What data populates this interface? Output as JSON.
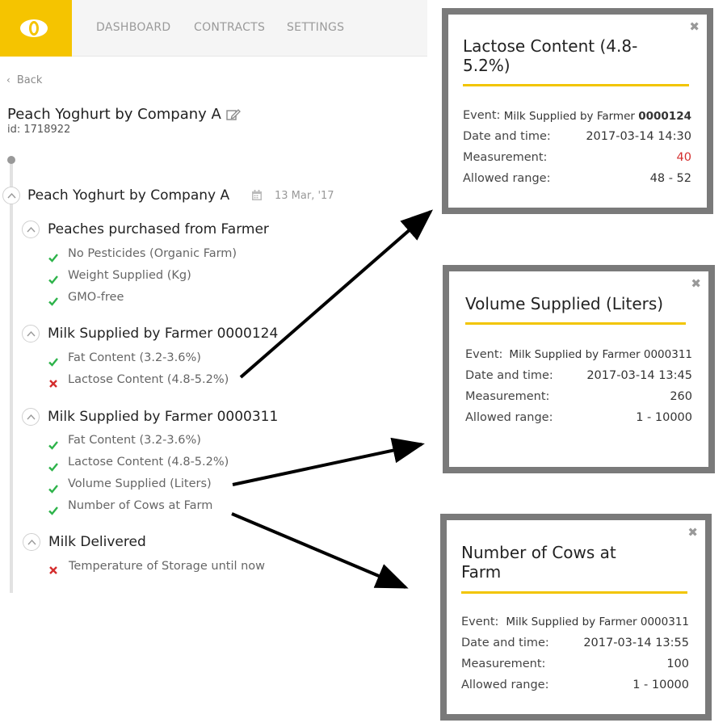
{
  "nav": {
    "items": [
      "DASHBOARD",
      "CONTRACTS",
      "SETTINGS"
    ]
  },
  "back_label": "Back",
  "product": {
    "title": "Peach Yoghurt by Company A",
    "id_text": "id: 1718922"
  },
  "timeline": {
    "root": {
      "title": "Peach Yoghurt by Company A",
      "date": "13 Mar, '17"
    },
    "events": [
      {
        "title": "Peaches purchased from Farmer",
        "items": [
          {
            "label": "No Pesticides (Organic Farm)",
            "status": "ok"
          },
          {
            "label": "Weight Supplied (Kg)",
            "status": "ok"
          },
          {
            "label": "GMO-free",
            "status": "ok"
          }
        ]
      },
      {
        "title": "Milk Supplied by Farmer 0000124",
        "items": [
          {
            "label": "Fat Content (3.2-3.6%)",
            "status": "ok"
          },
          {
            "label": "Lactose Content (4.8-5.2%)",
            "status": "fail"
          }
        ]
      },
      {
        "title": "Milk Supplied by Farmer 0000311",
        "items": [
          {
            "label": "Fat Content (3.2-3.6%)",
            "status": "ok"
          },
          {
            "label": "Lactose Content (4.8-5.2%)",
            "status": "ok"
          },
          {
            "label": "Volume Supplied (Liters)",
            "status": "ok"
          },
          {
            "label": "Number of Cows at Farm",
            "status": "ok"
          }
        ]
      },
      {
        "title": "Milk Delivered",
        "items": [
          {
            "label": "Temperature of Storage until now",
            "status": "fail"
          }
        ]
      }
    ]
  },
  "popups": [
    {
      "title": "Lactose Content (4.8-5.2%)",
      "event_label": "Event:",
      "event_prefix": "Milk Supplied by Farmer ",
      "event_number": "0000124",
      "date_label": "Date and time:",
      "date_value": "2017-03-14 14:30",
      "measurement_label": "Measurement:",
      "measurement_value": "40",
      "range_label": "Allowed range:",
      "range_value": "48 - 52"
    },
    {
      "title": "Volume Supplied (Liters)",
      "event_label": "Event:",
      "event_value": "Milk Supplied by Farmer 0000311",
      "date_label": "Date and time:",
      "date_value": "2017-03-14 13:45",
      "measurement_label": "Measurement:",
      "measurement_value": "260",
      "range_label": "Allowed range:",
      "range_value": "1 - 10000"
    },
    {
      "title": "Number of Cows at Farm",
      "event_label": "Event:",
      "event_value": "Milk Supplied by Farmer 0000311",
      "date_label": "Date and time:",
      "date_value": "2017-03-14 13:55",
      "measurement_label": "Measurement:",
      "measurement_value": "100",
      "range_label": "Allowed range:",
      "range_value": "1 - 10000"
    }
  ],
  "colors": {
    "brand_yellow": "#f5c400",
    "ok_green": "#2db34a",
    "fail_red": "#d42d2d"
  },
  "icons": [
    "eye-logo-icon",
    "chevron-left-icon",
    "edit-icon",
    "calendar-icon",
    "chevron-up-icon",
    "check-icon",
    "cross-icon",
    "close-icon"
  ]
}
